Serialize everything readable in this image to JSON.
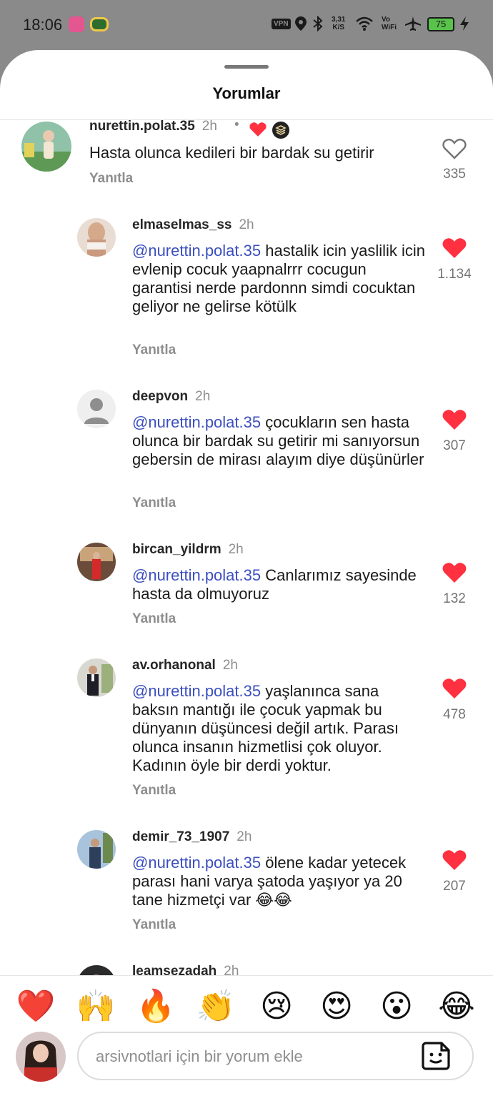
{
  "status_bar": {
    "time": "18:06",
    "vpn": "VPN",
    "speed_value": "3,31",
    "speed_unit": "K/S",
    "vowifi_top": "Vo",
    "vowifi_bottom": "WiFi",
    "battery": "75"
  },
  "sheet": {
    "title": "Yorumlar"
  },
  "comments": [
    {
      "username": "nurettin.polat.35",
      "time": "2h",
      "dot": "•",
      "mention": "",
      "text": "Hasta olunca kedileri bir bardak su getirir",
      "reply": "Yanıtla",
      "likes": "335",
      "liked": false
    },
    {
      "username": "elmaselmas_ss",
      "time": "2h",
      "mention": "@nurettin.polat.35",
      "text": "hastalik icin yaslilik icin evlenip cocuk yaapnalrrr cocugun garantisi nerde pardonnn simdi cocuktan geliyor ne gelirse kötülk",
      "reply": "Yanıtla",
      "likes": "1.134",
      "liked": true
    },
    {
      "username": "deepvon",
      "time": "2h",
      "mention": "@nurettin.polat.35",
      "text": "çocukların sen hasta olunca bir bardak su getirir mi sanıyorsun gebersin de mirası alayım diye düşünürler",
      "reply": "Yanıtla",
      "likes": "307",
      "liked": true
    },
    {
      "username": "bircan_yildrm",
      "time": "2h",
      "mention": "@nurettin.polat.35",
      "text": " Canlarımız sayesinde hasta da olmuyoruz",
      "reply": "Yanıtla",
      "likes": "132",
      "liked": true
    },
    {
      "username": "av.orhanonal",
      "time": "2h",
      "mention": "@nurettin.polat.35",
      "text": "yaşlanınca sana baksın mantığı ile çocuk yapmak bu dünyanın düşüncesi değil artık. Parası olunca insanın hizmetlisi çok oluyor. Kadının öyle bir derdi yoktur.",
      "reply": "Yanıtla",
      "likes": "478",
      "liked": true
    },
    {
      "username": "demir_73_1907",
      "time": "2h",
      "mention": "@nurettin.polat.35",
      "text": "ölene kadar yetecek parası hani varya şatoda yaşıyor ya 20 tane hizmetçi var 😂😂",
      "reply": "Yanıtla",
      "likes": "207",
      "liked": true
    },
    {
      "username": "leamsezadah",
      "time": "2h",
      "mention": "",
      "text": "",
      "reply": "",
      "likes": "",
      "liked": false
    }
  ],
  "reactions": [
    "❤️",
    "🙌",
    "🔥",
    "👏",
    "😢",
    "😍",
    "😮",
    "😂"
  ],
  "comment_input": {
    "placeholder": "arsivnotlari için bir yorum ekle"
  },
  "colors": {
    "like_red": "#ff3040",
    "mention_blue": "#3b4fbf",
    "background_dim": "#8a8a8a"
  },
  "icons": [
    "heart-icon",
    "sticker-icon",
    "location-icon",
    "bluetooth-icon",
    "wifi-icon",
    "airplane-icon",
    "battery-icon"
  ]
}
